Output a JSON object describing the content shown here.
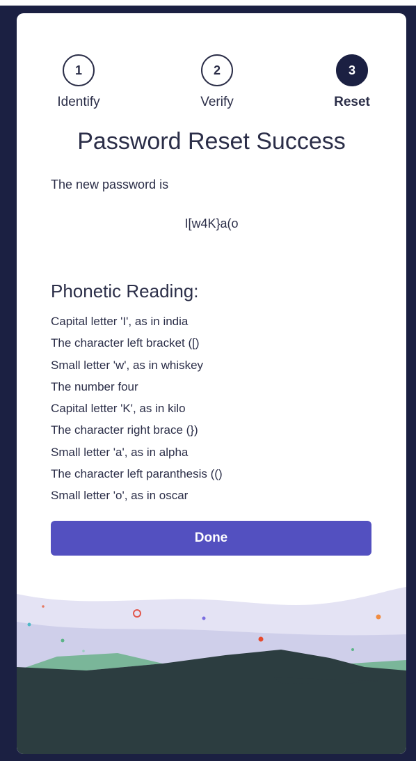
{
  "steps": [
    {
      "number": "1",
      "label": "Identify"
    },
    {
      "number": "2",
      "label": "Verify"
    },
    {
      "number": "3",
      "label": "Reset"
    }
  ],
  "title": "Password Reset Success",
  "intro": "The new password is",
  "password": "I[w4K}a(o",
  "phonetic": {
    "heading": "Phonetic Reading:",
    "items": [
      "Capital letter 'I', as in india",
      "The character left bracket ([)",
      "Small letter 'w', as in whiskey",
      "The number four",
      "Capital letter 'K', as in kilo",
      "The character right brace (})",
      "Small letter 'a', as in alpha",
      "The character left paranthesis (()",
      "Small letter 'o', as in oscar"
    ]
  },
  "done_label": "Done",
  "colors": {
    "frame": "#1b2042",
    "accent": "#5350c0",
    "text": "#2b2e48",
    "hill_dark": "#2c3d40",
    "hill_green": "#7ab699",
    "hill_lavender": "#d6d6ee"
  }
}
